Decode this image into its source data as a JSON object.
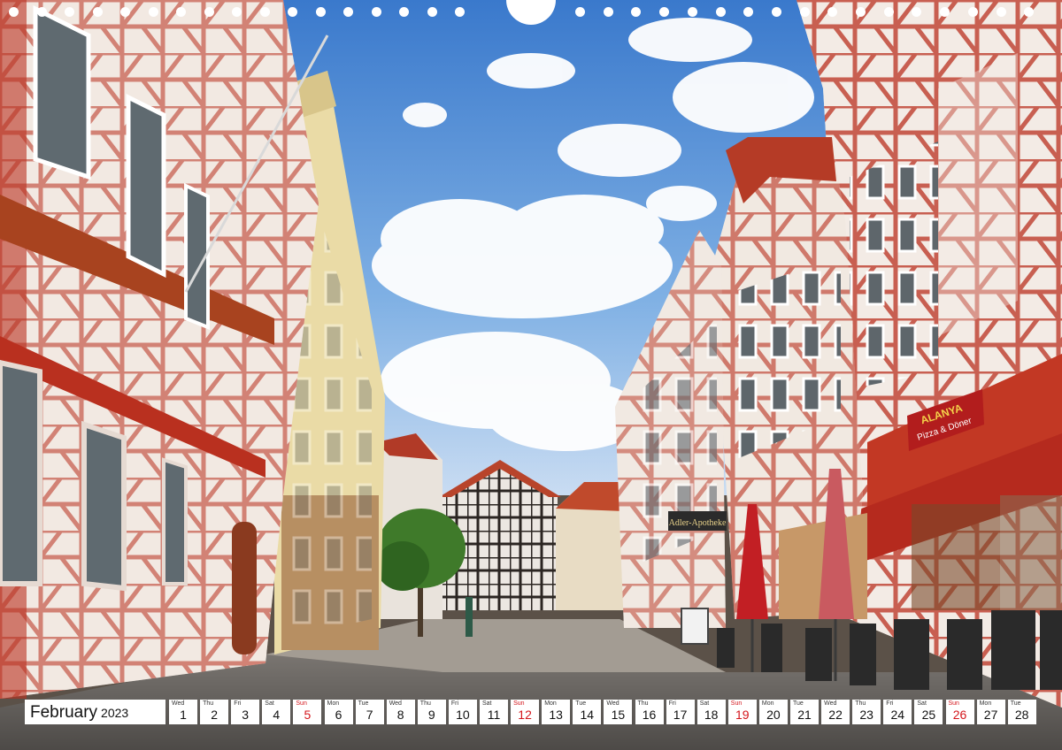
{
  "calendar": {
    "month": "February",
    "year": "2023",
    "days": [
      {
        "dow": "Wed",
        "num": "1",
        "sun": false
      },
      {
        "dow": "Thu",
        "num": "2",
        "sun": false
      },
      {
        "dow": "Fri",
        "num": "3",
        "sun": false
      },
      {
        "dow": "Sat",
        "num": "4",
        "sun": false
      },
      {
        "dow": "Sun",
        "num": "5",
        "sun": true
      },
      {
        "dow": "Mon",
        "num": "6",
        "sun": false
      },
      {
        "dow": "Tue",
        "num": "7",
        "sun": false
      },
      {
        "dow": "Wed",
        "num": "8",
        "sun": false
      },
      {
        "dow": "Thu",
        "num": "9",
        "sun": false
      },
      {
        "dow": "Fri",
        "num": "10",
        "sun": false
      },
      {
        "dow": "Sat",
        "num": "11",
        "sun": false
      },
      {
        "dow": "Sun",
        "num": "12",
        "sun": true
      },
      {
        "dow": "Mon",
        "num": "13",
        "sun": false
      },
      {
        "dow": "Tue",
        "num": "14",
        "sun": false
      },
      {
        "dow": "Wed",
        "num": "15",
        "sun": false
      },
      {
        "dow": "Thu",
        "num": "16",
        "sun": false
      },
      {
        "dow": "Fri",
        "num": "17",
        "sun": false
      },
      {
        "dow": "Sat",
        "num": "18",
        "sun": false
      },
      {
        "dow": "Sun",
        "num": "19",
        "sun": true
      },
      {
        "dow": "Mon",
        "num": "20",
        "sun": false
      },
      {
        "dow": "Tue",
        "num": "21",
        "sun": false
      },
      {
        "dow": "Wed",
        "num": "22",
        "sun": false
      },
      {
        "dow": "Thu",
        "num": "23",
        "sun": false
      },
      {
        "dow": "Fri",
        "num": "24",
        "sun": false
      },
      {
        "dow": "Sat",
        "num": "25",
        "sun": false
      },
      {
        "dow": "Sun",
        "num": "26",
        "sun": true
      },
      {
        "dow": "Mon",
        "num": "27",
        "sun": false
      },
      {
        "dow": "Tue",
        "num": "28",
        "sun": false
      }
    ]
  },
  "signs": {
    "pharmacy": "Adler-Apotheke",
    "restaurant": "ALANYA",
    "restaurant_sub": "Pizza & Döner"
  },
  "colors": {
    "sky_top": "#3f7fd0",
    "timber_red": "#b9301f",
    "sunday_red": "#d4151b"
  }
}
